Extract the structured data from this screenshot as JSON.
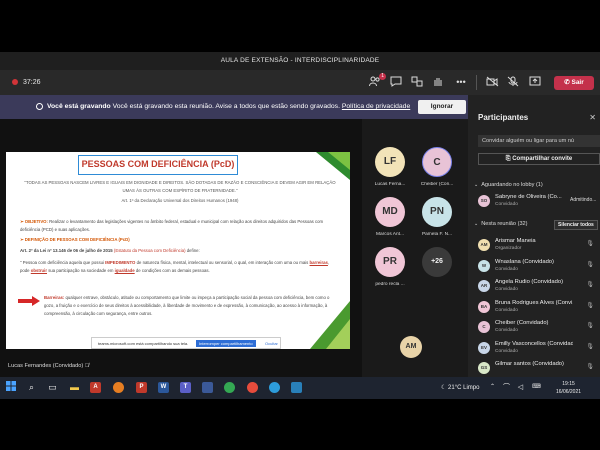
{
  "window": {
    "title": "AULA DE EXTENSÃO - INTERDISCIPLINARIDADE"
  },
  "meeting_bar": {
    "timer": "37:26",
    "participants_badge": "1",
    "leave_label": "Sair"
  },
  "recording": {
    "title": "Você está gravando",
    "message": "Você está gravando esta reunião. Avise a todos que estão sendo gravados.",
    "policy_link": "Política de privacidade",
    "dismiss_label": "Ignorar"
  },
  "slide": {
    "title": "PESSOAS COM DEFICIÊNCIA (PcD)",
    "quote": "\"TODAS AS PESSOAS NASCEM LIVRES E IGUAIS EM DIGNIDADE E DIREITOS. SÃO DOTADAS DE RAZÃO E CONSCIÊNCIA E DEVEM AGIR EM RELAÇÃO UMAS ÀS OUTRAS COM ESPÍRITO DE FRATERNIDADE.\"",
    "citation": "Art. 1º da Declaração Universal dos Direitos Humanos (1948)",
    "objective_label": "OBJETIVO:",
    "objective_text": "Realizar o levantamento das legislações vigentes no âmbito federal, estadual e municipal com relação aos direitos adquiridos das Pessoas com deficiência (PCD) e suas aplicações.",
    "definition_label": "DEFINIÇÃO DE PESSOAS COM DEFICIÊNCIA (PcD)",
    "law_prefix": "Art. 2º da Lei nº 13.146 de 06 de julho de 2015",
    "law_statute": "(Estatuto da Pessoa com Deficiência)",
    "law_suffix": "define:",
    "definition_1": "\" Pessoa com deficiência aquela que possui",
    "definition_imp": "IMPEDIMENTO",
    "definition_2": "de natureza física, mental, intelectual ou sensorial, o qual, em interação com uma ou mais",
    "definition_bar": "barreiras",
    "definition_3": ", pode",
    "definition_obs": "obstruir",
    "definition_4": "sua participação na sociedade em",
    "definition_ig": "igualdade",
    "definition_5": "de condições com as demais pessoas.",
    "barrier_label": "Barreiras:",
    "barrier_text": "qualquer entrave, obstáculo, atitude ou comportamento que limite ou impeça a participação social da pessoa com deficiência, bem como o gozo, a fruição e o exercício de seus direitos à acessibilidade, à liberdade de movimento e de expressão, à comunicação, ao acesso à informação, à compreensão, à circulação com segurança, entre outros."
  },
  "share_bar": {
    "text": "teams.microsoft.com está compartilhando sua tela.",
    "stop_label": "Interromper compartilhamento",
    "hide_label": "Ocultar"
  },
  "presenter": {
    "name": "Lucas Fernandes (Convidado)"
  },
  "tiles": [
    {
      "initials": "LF",
      "name": "Lucas Ferna...",
      "color": "#f2e3b8"
    },
    {
      "initials": "C",
      "name": "Cheiber (Con...",
      "color": "#e8c3d6"
    },
    {
      "initials": "MD",
      "name": "Marcos Ant...",
      "color": "#f0c6d6"
    },
    {
      "initials": "PN",
      "name": "Pamela F. N...",
      "color": "#c8e3e8"
    },
    {
      "initials": "PR",
      "name": "pedro recla ...",
      "color": "#f0c6d6"
    },
    {
      "initials": "+26",
      "name": "",
      "color": "#3a3a3a"
    }
  ],
  "self_view": {
    "initials": "AM"
  },
  "panel": {
    "title": "Participantes",
    "invite_placeholder": "Convidar alguém ou ligar para um nú",
    "share_invite_label": "Compartilhar convite",
    "lobby_header": "Aguardando no lobby (1)",
    "admit_label": "Admitindo...",
    "meeting_header": "Nesta reunião (32)",
    "mute_all_label": "Silenciar todos",
    "lobby": [
      {
        "initials": "SO",
        "name": "Sabryne de Oliveira (Co...",
        "role": "Convidado",
        "color": "#e8c3d6"
      }
    ],
    "people": [
      {
        "initials": "AM",
        "name": "Arismar Maneia",
        "role": "Organizador",
        "color": "#f0dfb0"
      },
      {
        "initials": "W",
        "name": "Wnaslana (Convidado)",
        "role": "Convidado",
        "color": "#c8e3e8"
      },
      {
        "initials": "AR",
        "name": "Angela Rudio (Convidado)",
        "role": "Convidado",
        "color": "#c8d6e8"
      },
      {
        "initials": "BA",
        "name": "Bruna Rodrigues Alves (Convi...",
        "role": "Convidado",
        "color": "#f0c6d6"
      },
      {
        "initials": "C",
        "name": "Cheiber (Convidado)",
        "role": "Convidado",
        "color": "#e8c3d6"
      },
      {
        "initials": "EV",
        "name": "Emilly Vasconcellos (Convidad...",
        "role": "Convidado",
        "color": "#c8d6e8"
      },
      {
        "initials": "GS",
        "name": "Gilmar santos (Convidado)",
        "role": "",
        "color": "#d9e8c8"
      }
    ]
  },
  "taskbar": {
    "weather": "21°C  Limpo",
    "time": "19:15",
    "date": "16/06/2021"
  }
}
